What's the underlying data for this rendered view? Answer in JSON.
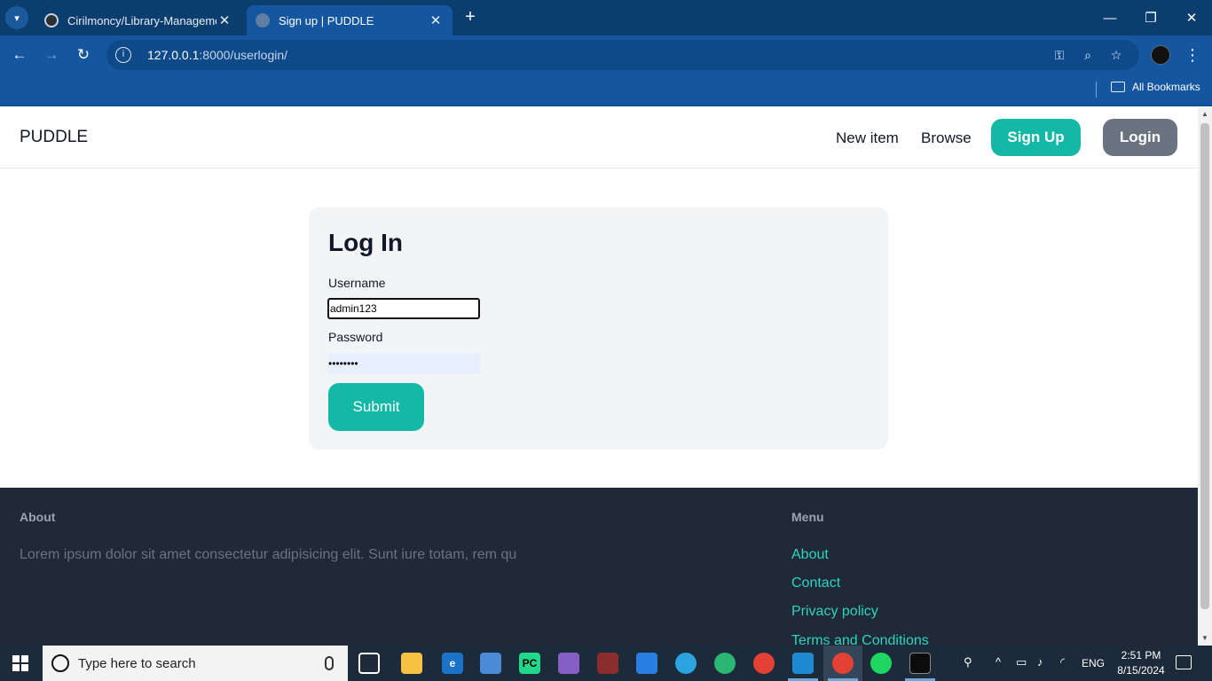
{
  "browser": {
    "tabs": [
      {
        "title": "Cirilmoncy/Library-Management",
        "active": false
      },
      {
        "title": "Sign up | PUDDLE",
        "active": true
      }
    ],
    "url_host": "127.0.0.1",
    "url_path": ":8000/userlogin/",
    "bookmarks_all": "All Bookmarks"
  },
  "site": {
    "brand": "PUDDLE",
    "nav": {
      "new_item": "New item",
      "browse": "Browse",
      "signup": "Sign Up",
      "login": "Login"
    }
  },
  "login_form": {
    "title": "Log In",
    "username_label": "Username",
    "username_value": "admin123",
    "password_label": "Password",
    "password_value": "••••••••",
    "submit_label": "Submit"
  },
  "footer": {
    "about_heading": "About",
    "about_text": "Lorem ipsum dolor sit amet consectetur adipisicing elit. Sunt iure totam, rem qu",
    "menu_heading": "Menu",
    "menu_links": [
      "About",
      "Contact",
      "Privacy policy",
      "Terms and Conditions"
    ]
  },
  "taskbar": {
    "search_placeholder": "Type here to search",
    "language": "ENG",
    "time": "2:51 PM",
    "date": "8/15/2024"
  },
  "colors": {
    "accent_teal": "#14b8a6",
    "login_gray": "#6b7280",
    "footer_bg": "#1f2937",
    "footer_link": "#2dd4bf",
    "browser_chrome": "#1556a0"
  }
}
